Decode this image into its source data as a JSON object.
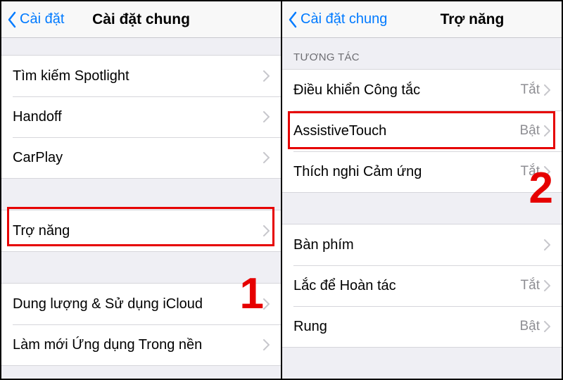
{
  "left": {
    "nav": {
      "back": "Cài đặt",
      "title": "Cài đặt chung"
    },
    "group1": [
      {
        "label": "Tìm kiếm Spotlight"
      },
      {
        "label": "Handoff"
      },
      {
        "label": "CarPlay"
      }
    ],
    "group2": [
      {
        "label": "Trợ năng"
      }
    ],
    "group3": [
      {
        "label": "Dung lượng & Sử dụng iCloud"
      },
      {
        "label": "Làm mới Ứng dụng Trong nền"
      }
    ],
    "step": "1"
  },
  "right": {
    "nav": {
      "back": "Cài đặt chung",
      "title": "Trợ năng"
    },
    "section1": {
      "header": "TƯƠNG TÁC",
      "rows": [
        {
          "label": "Điều khiển Công tắc",
          "status": "Tắt"
        },
        {
          "label": "AssistiveTouch",
          "status": "Bật"
        },
        {
          "label": "Thích nghi Cảm ứng",
          "status": "Tắt"
        }
      ]
    },
    "section2": {
      "rows": [
        {
          "label": "Bàn phím",
          "status": ""
        },
        {
          "label": "Lắc để Hoàn tác",
          "status": "Tắt"
        },
        {
          "label": "Rung",
          "status": "Bật"
        }
      ]
    },
    "step": "2"
  }
}
